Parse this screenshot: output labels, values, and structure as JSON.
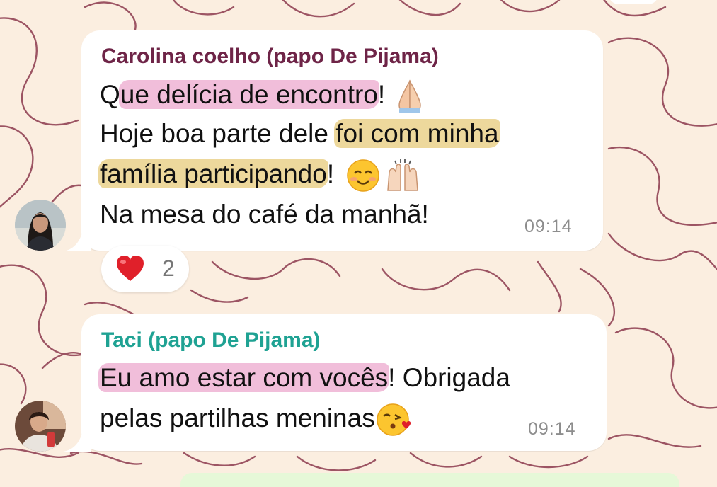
{
  "theme": {
    "wallpaper_bg": "#fbeee0",
    "wallpaper_stroke": "#8c3a4e",
    "bubble_bg": "#ffffff",
    "highlight_pink": "#e896c4",
    "highlight_gold": "#e2c05f",
    "sender1_color": "#6e2447",
    "sender2_color": "#1fa293",
    "time_color": "#8d8d8d"
  },
  "messages": [
    {
      "sender": "Carolina coelho (papo De Pijama)",
      "line1": {
        "pre": "Q",
        "highlight": "ue delícia de encontro",
        "post": "!"
      },
      "line1_emoji": "folded-hands-emoji",
      "line2": {
        "pre": "Hoje boa parte dele ",
        "highlight": "foi com minha"
      },
      "line3": {
        "highlight": "família participando",
        "post": "!"
      },
      "line3_emojis": [
        "smiling-face-emoji",
        "raising-hands-emoji"
      ],
      "line4": "Na mesa do café da manhã!",
      "time": "09:14",
      "reaction": {
        "emoji": "red-heart-icon",
        "count": "2"
      }
    },
    {
      "sender": "Taci (papo De Pijama)",
      "line1": {
        "highlight": "Eu amo estar com vocês",
        "post": "! Obrigada"
      },
      "line2": "pelas partilhas meninas",
      "line2_emoji": "face-blowing-kiss-emoji",
      "time": "09:14"
    }
  ]
}
